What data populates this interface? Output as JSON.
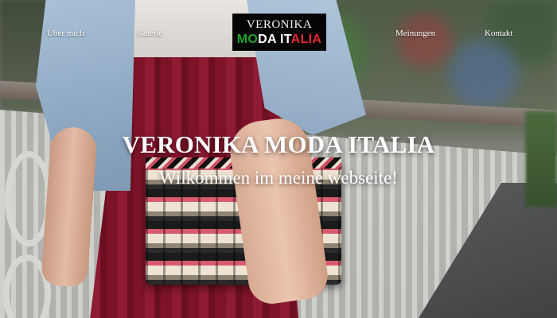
{
  "nav": {
    "items": [
      {
        "id": "about",
        "label": "Über mich"
      },
      {
        "id": "gallery",
        "label": "Galerie"
      },
      {
        "id": "reviews",
        "label": "Meinungen"
      },
      {
        "id": "contact",
        "label": "Kontakt"
      }
    ]
  },
  "logo": {
    "line1": "VERONIKA",
    "line2_parts": [
      "MO",
      "DA IT",
      "ALIA"
    ],
    "colors": {
      "green": "#1fa32e",
      "white": "#ffffff",
      "red": "#e3282a",
      "background": "#050505"
    }
  },
  "hero": {
    "title": "VERONIKA MODA ITALIA",
    "subtitle": "Wilkommen im meine webseite!"
  }
}
